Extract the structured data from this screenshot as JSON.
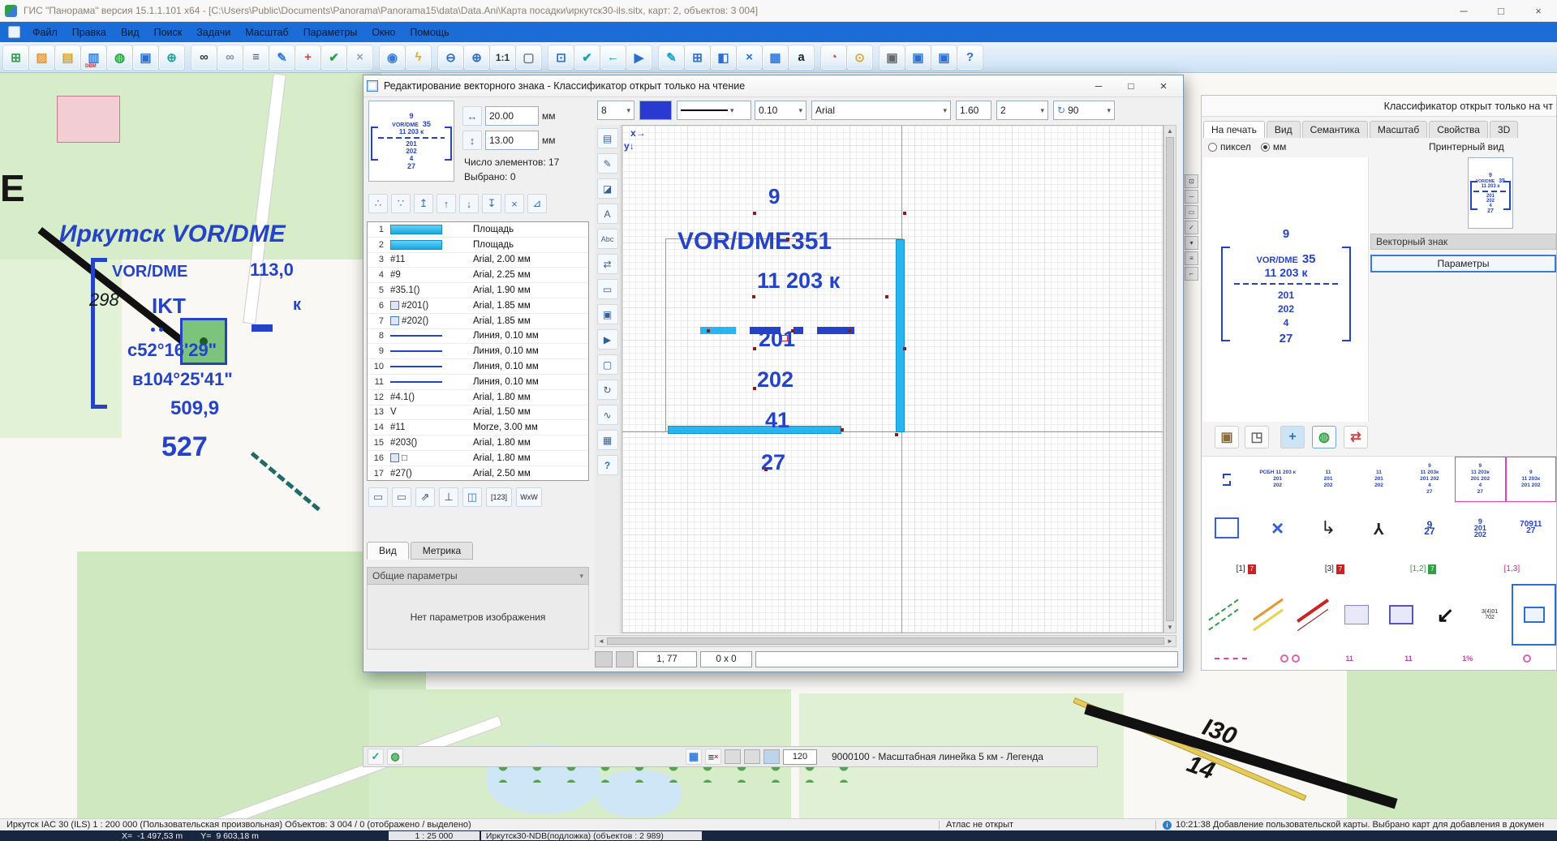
{
  "ui": {
    "caret": "▾",
    "left": "◄",
    "right": "►",
    "up": "▲",
    "down": "▼",
    "ar": "→",
    "ad": "↓"
  },
  "window": {
    "title": "ГИС \"Панорама\" версия 15.1.1.101 x64 - [C:\\Users\\Public\\Documents\\Panorama\\Panorama15\\data\\Data.Ani\\Карта посадки\\иркутск30-ils.sitx, карт: 2, объектов: 3 004]",
    "min": "─",
    "max": "□",
    "close": "×"
  },
  "menu": {
    "items": [
      "Файл",
      "Правка",
      "Вид",
      "Поиск",
      "Задачи",
      "Масштаб",
      "Параметры",
      "Окно",
      "Помощь"
    ]
  },
  "toolbar": {
    "dbm": "DBM",
    "icons": [
      "⊞",
      "▨",
      "▤",
      "▥",
      "◍",
      "▣",
      "⊕",
      "∞",
      "∞",
      "≡",
      "✎",
      "+",
      "✔",
      "×",
      "◉",
      "ϟ",
      "⊖",
      "⊕",
      "1:1",
      "▢",
      "⊡",
      "✔",
      "←",
      "▶",
      "✎",
      "⊞",
      "◧",
      "×",
      "▦",
      "a",
      "◔",
      "⊙",
      "▣",
      "▣",
      "▣",
      "?"
    ]
  },
  "map": {
    "letter_e": "E",
    "title": "Иркутск VOR/DME",
    "vordme": "VOR/DME",
    "freq": "113,0",
    "course": "298°",
    "ident": "IKT",
    "k": "к",
    "lat": "с52°16'29\"",
    "lon": "в104°25'41\"",
    "elev": "509,9",
    "alt": "527",
    "runway1": "I30",
    "runway2": "14"
  },
  "legend": {
    "i1": "✓",
    "i2": "◍",
    "i3": "▦",
    "i4": "≡",
    "close": "×",
    "value": "120",
    "text": "9000100 - Масштабная линейка 5 км - Легенда"
  },
  "sign": {
    "top": "9",
    "name": "VOR/DME",
    "size": "35",
    "freq": "11  203 к",
    "l1": "201",
    "l2": "202",
    "l3": "4",
    "l4": "27"
  },
  "dialog": {
    "title": "Редактирование векторного знака - Классификатор открыт только на чтение",
    "tb": {
      "size": "8",
      "width": "0.10",
      "font": "Arial",
      "height": "1.60",
      "count": "2",
      "rot": "↻",
      "angle": "90"
    },
    "m": {
      "iw": "↔",
      "ih": "↕",
      "w": "20.00",
      "h": "13.00",
      "u1": "мм",
      "u2": "мм",
      "elems": "Число элементов: 17",
      "sel": "Выбрано: 0"
    },
    "small": [
      "∴",
      "∵",
      "↥",
      "↑",
      "↓",
      "↧",
      "×",
      "⊿"
    ],
    "strip": [
      "▤",
      "✎",
      "◪",
      "A",
      "Abc",
      "⇄",
      "▭",
      "▣",
      "▶",
      "▢",
      "↻",
      "∿",
      "▦",
      "?"
    ],
    "bottom": [
      "▭",
      "▭",
      "⇗",
      "⊥",
      "◫",
      "[123]",
      "WxW"
    ],
    "rows": [
      {
        "n": "1",
        "code": "",
        "desc": "Площадь"
      },
      {
        "n": "2",
        "code": "",
        "desc": "Площадь"
      },
      {
        "n": "3",
        "code": "#11",
        "desc": "Arial, 2.00 мм"
      },
      {
        "n": "4",
        "code": "#9",
        "desc": "Arial, 2.25 мм"
      },
      {
        "n": "5",
        "code": "#35.1()",
        "desc": "Arial, 1.90 мм"
      },
      {
        "n": "6",
        "code": "#201()",
        "desc": "Arial, 1.85 мм"
      },
      {
        "n": "7",
        "code": "#202()",
        "desc": "Arial, 1.85 мм"
      },
      {
        "n": "8",
        "code": "",
        "desc": "Линия, 0.10 мм"
      },
      {
        "n": "9",
        "code": "",
        "desc": "Линия, 0.10 мм"
      },
      {
        "n": "10",
        "code": "",
        "desc": "Линия, 0.10 мм"
      },
      {
        "n": "11",
        "code": "",
        "desc": "Линия, 0.10 мм"
      },
      {
        "n": "12",
        "code": "#4.1()",
        "desc": "Arial, 1.80 мм"
      },
      {
        "n": "13",
        "code": "V",
        "desc": "Arial, 1.50 мм"
      },
      {
        "n": "14",
        "code": "#11",
        "desc": "Morze, 3.00 мм"
      },
      {
        "n": "15",
        "code": "#203()",
        "desc": "Arial, 1.80 мм"
      },
      {
        "n": "16",
        "code": "□",
        "desc": "Arial, 1.80 мм"
      },
      {
        "n": "17",
        "code": "#27()",
        "desc": "Arial, 2.50 мм"
      }
    ],
    "tabs": {
      "t1": "Вид",
      "t2": "Метрика"
    },
    "ph": "Общие параметры",
    "np": "Нет параметров изображения",
    "cv": {
      "ax": "x",
      "ay": "y",
      "t9": "9",
      "name": "VOR/DME351",
      "freq": "11 203 к",
      "n201": "201",
      "n202": "202",
      "n41": "41",
      "n27": "27"
    },
    "st": {
      "pos": "1, 77",
      "dim": "0 x 0"
    }
  },
  "right": {
    "header": "Классификатор открыт только на чт",
    "tabs": [
      "На печать",
      "Вид",
      "Семантика",
      "Масштаб",
      "Свойства",
      "3D"
    ],
    "rpx": "пиксел",
    "rmm": "мм",
    "pv": "Принтерный вид",
    "vz": "Векторный знак",
    "params": "Параметры",
    "icons": {
      "add": "+",
      "del": "×",
      "undo": "↶",
      "fwd": "→",
      "b1": "▣",
      "b2": "◳",
      "b3": "+",
      "b4": "◍",
      "b5": "⇄"
    },
    "mini": [
      "⊡",
      "─",
      "▭",
      "✓",
      "▾",
      "≡",
      "⌐"
    ]
  },
  "palette": {
    "r1c2": [
      "РСБН 11 203 к",
      "201",
      "202"
    ],
    "r1c3": [
      "11",
      "201",
      "202"
    ],
    "r1c4": [
      "11",
      "201",
      "202"
    ],
    "sign_sm": [
      "9",
      "11 203к",
      "201 202",
      "4",
      "27"
    ],
    "r2c2": "×",
    "r2c3": "↳",
    "r2c4": "Y",
    "r2c5": [
      "9",
      "27"
    ],
    "r2c6": [
      "9",
      "201",
      "202"
    ],
    "r2c7": [
      "70911",
      "27"
    ],
    "r3": [
      {
        "l": "[1]",
        "c": "7"
      },
      {
        "l": "[3]",
        "c": "7"
      },
      {
        "l": "[1,2]",
        "c": "7"
      },
      {
        "l": "[1,3]",
        "c": ""
      }
    ],
    "r4c6": "↙",
    "r4c7": [
      "3(4)01",
      "702"
    ],
    "r5c3": "11",
    "r5c4": "11",
    "r5c5": "1%"
  },
  "status1": {
    "left": "Иркутск IAC 30 (ILS)  1 : 200 000 (Пользовательская произвольная) Объектов: 3 004 / 0 (отображено / выделено)",
    "atlas": "Атлас не открыт",
    "i": "i",
    "msg": "10:21:38  Добавление пользовательской карты. Выбрано карт для добавления в докумен"
  },
  "status2": {
    "xl": "X=",
    "x": "-1 497,53 m",
    "yl": "Y=",
    "y": "9 603,18 m",
    "scale": "1 : 25 000",
    "map": "Иркутск30-NDB(подложка)   (объектов : 2 989)"
  }
}
